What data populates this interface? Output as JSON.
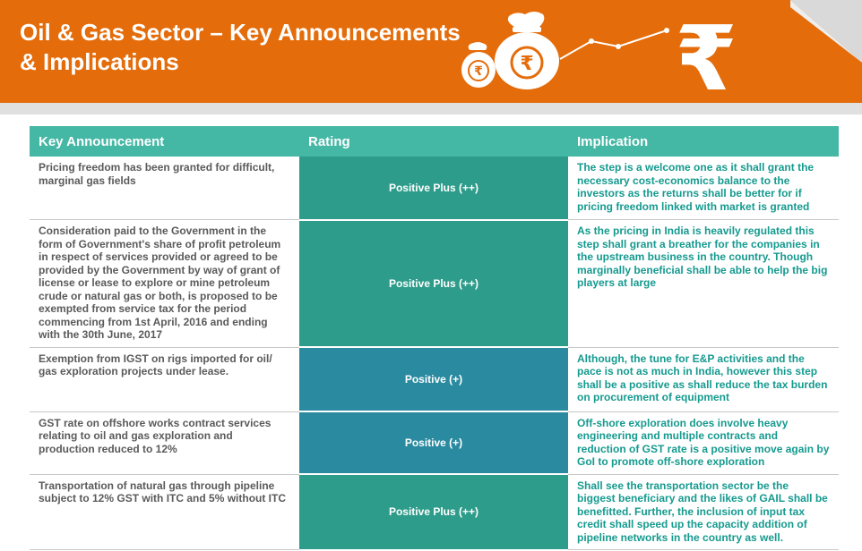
{
  "header": {
    "title_line1": "Oil & Gas Sector – Key Announcements",
    "title_line2": "& Implications",
    "bg_color": "#e46c0a",
    "icons": [
      "money-bag-rupee-icon",
      "money-bag-rupee-icon",
      "rising-trend-line-icon",
      "rupee-symbol-icon"
    ]
  },
  "table": {
    "columns": [
      "Key Announcement",
      "Rating",
      "Implication"
    ],
    "header_color": "#45b7a5",
    "rows": [
      {
        "announcement": "Pricing freedom has been granted for difficult, marginal gas fields",
        "rating": "Positive Plus (++)",
        "rating_color": "#2e9c8a",
        "implication": "The step is a welcome one as it shall grant the necessary cost-economics balance to the investors as the returns shall be better for if pricing freedom linked with market is granted"
      },
      {
        "announcement": "Consideration paid to the Government in the form of Government's share of profit petroleum in respect of services provided or agreed to be provided by the Government by way of grant of license or lease to explore or mine petroleum crude or natural gas or both, is proposed to be exempted from service tax for the period commencing from 1st April, 2016 and ending with the 30th June, 2017",
        "rating": "Positive Plus (++)",
        "rating_color": "#2e9c8a",
        "implication": "As the pricing in India is heavily regulated this step shall grant a breather for the companies in the upstream business in the country. Though marginally beneficial  shall be able to help the big players at large"
      },
      {
        "announcement": "Exemption from IGST on rigs imported for oil/ gas exploration projects under lease.",
        "rating": "Positive (+)",
        "rating_color": "#2a8aa0",
        "implication": "Although, the tune for E&P activities and the pace is not as much in India, however this step shall be a positive as shall reduce the tax burden on procurement of equipment"
      },
      {
        "announcement": "GST rate on offshore works contract services relating to oil and gas exploration and production reduced to 12%",
        "rating": "Positive (+)",
        "rating_color": "#2a8aa0",
        "implication": "Off-shore exploration does involve heavy engineering and multiple contracts and reduction of GST rate is a positive move again by GoI to promote off-shore exploration"
      },
      {
        "announcement": "Transportation of natural gas through pipeline subject to 12% GST with ITC and 5% without ITC",
        "rating": "Positive Plus (++)",
        "rating_color": "#2e9c8a",
        "implication": "Shall see the transportation sector be the biggest beneficiary and the likes of GAIL shall be benefitted. Further, the inclusion of input tax credit shall speed up the capacity addition of pipeline networks in the country as well."
      }
    ]
  }
}
